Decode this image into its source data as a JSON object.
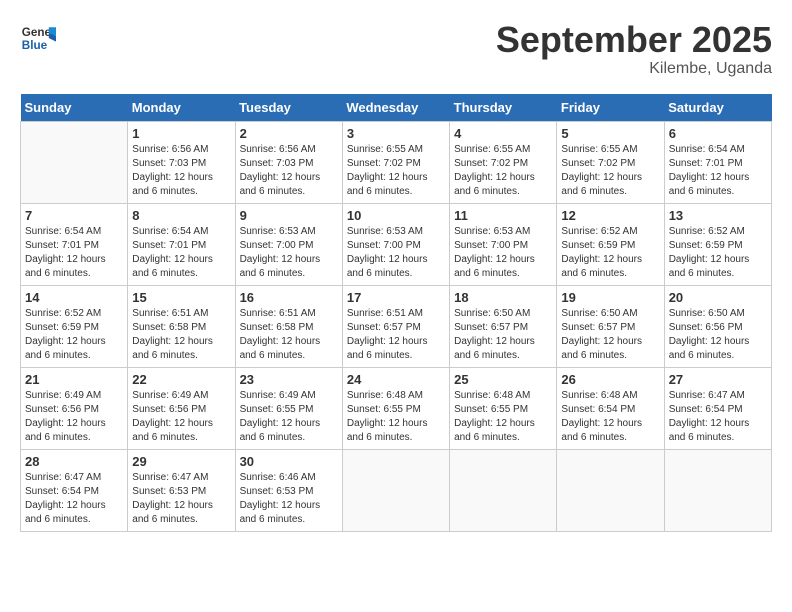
{
  "logo": {
    "line1": "General",
    "line2": "Blue"
  },
  "title": "September 2025",
  "subtitle": "Kilembe, Uganda",
  "days_of_week": [
    "Sunday",
    "Monday",
    "Tuesday",
    "Wednesday",
    "Thursday",
    "Friday",
    "Saturday"
  ],
  "weeks": [
    [
      {
        "day": "",
        "info": ""
      },
      {
        "day": "1",
        "info": "Sunrise: 6:56 AM\nSunset: 7:03 PM\nDaylight: 12 hours\nand 6 minutes."
      },
      {
        "day": "2",
        "info": "Sunrise: 6:56 AM\nSunset: 7:03 PM\nDaylight: 12 hours\nand 6 minutes."
      },
      {
        "day": "3",
        "info": "Sunrise: 6:55 AM\nSunset: 7:02 PM\nDaylight: 12 hours\nand 6 minutes."
      },
      {
        "day": "4",
        "info": "Sunrise: 6:55 AM\nSunset: 7:02 PM\nDaylight: 12 hours\nand 6 minutes."
      },
      {
        "day": "5",
        "info": "Sunrise: 6:55 AM\nSunset: 7:02 PM\nDaylight: 12 hours\nand 6 minutes."
      },
      {
        "day": "6",
        "info": "Sunrise: 6:54 AM\nSunset: 7:01 PM\nDaylight: 12 hours\nand 6 minutes."
      }
    ],
    [
      {
        "day": "7",
        "info": "Sunrise: 6:54 AM\nSunset: 7:01 PM\nDaylight: 12 hours\nand 6 minutes."
      },
      {
        "day": "8",
        "info": "Sunrise: 6:54 AM\nSunset: 7:01 PM\nDaylight: 12 hours\nand 6 minutes."
      },
      {
        "day": "9",
        "info": "Sunrise: 6:53 AM\nSunset: 7:00 PM\nDaylight: 12 hours\nand 6 minutes."
      },
      {
        "day": "10",
        "info": "Sunrise: 6:53 AM\nSunset: 7:00 PM\nDaylight: 12 hours\nand 6 minutes."
      },
      {
        "day": "11",
        "info": "Sunrise: 6:53 AM\nSunset: 7:00 PM\nDaylight: 12 hours\nand 6 minutes."
      },
      {
        "day": "12",
        "info": "Sunrise: 6:52 AM\nSunset: 6:59 PM\nDaylight: 12 hours\nand 6 minutes."
      },
      {
        "day": "13",
        "info": "Sunrise: 6:52 AM\nSunset: 6:59 PM\nDaylight: 12 hours\nand 6 minutes."
      }
    ],
    [
      {
        "day": "14",
        "info": "Sunrise: 6:52 AM\nSunset: 6:59 PM\nDaylight: 12 hours\nand 6 minutes."
      },
      {
        "day": "15",
        "info": "Sunrise: 6:51 AM\nSunset: 6:58 PM\nDaylight: 12 hours\nand 6 minutes."
      },
      {
        "day": "16",
        "info": "Sunrise: 6:51 AM\nSunset: 6:58 PM\nDaylight: 12 hours\nand 6 minutes."
      },
      {
        "day": "17",
        "info": "Sunrise: 6:51 AM\nSunset: 6:57 PM\nDaylight: 12 hours\nand 6 minutes."
      },
      {
        "day": "18",
        "info": "Sunrise: 6:50 AM\nSunset: 6:57 PM\nDaylight: 12 hours\nand 6 minutes."
      },
      {
        "day": "19",
        "info": "Sunrise: 6:50 AM\nSunset: 6:57 PM\nDaylight: 12 hours\nand 6 minutes."
      },
      {
        "day": "20",
        "info": "Sunrise: 6:50 AM\nSunset: 6:56 PM\nDaylight: 12 hours\nand 6 minutes."
      }
    ],
    [
      {
        "day": "21",
        "info": "Sunrise: 6:49 AM\nSunset: 6:56 PM\nDaylight: 12 hours\nand 6 minutes."
      },
      {
        "day": "22",
        "info": "Sunrise: 6:49 AM\nSunset: 6:56 PM\nDaylight: 12 hours\nand 6 minutes."
      },
      {
        "day": "23",
        "info": "Sunrise: 6:49 AM\nSunset: 6:55 PM\nDaylight: 12 hours\nand 6 minutes."
      },
      {
        "day": "24",
        "info": "Sunrise: 6:48 AM\nSunset: 6:55 PM\nDaylight: 12 hours\nand 6 minutes."
      },
      {
        "day": "25",
        "info": "Sunrise: 6:48 AM\nSunset: 6:55 PM\nDaylight: 12 hours\nand 6 minutes."
      },
      {
        "day": "26",
        "info": "Sunrise: 6:48 AM\nSunset: 6:54 PM\nDaylight: 12 hours\nand 6 minutes."
      },
      {
        "day": "27",
        "info": "Sunrise: 6:47 AM\nSunset: 6:54 PM\nDaylight: 12 hours\nand 6 minutes."
      }
    ],
    [
      {
        "day": "28",
        "info": "Sunrise: 6:47 AM\nSunset: 6:54 PM\nDaylight: 12 hours\nand 6 minutes."
      },
      {
        "day": "29",
        "info": "Sunrise: 6:47 AM\nSunset: 6:53 PM\nDaylight: 12 hours\nand 6 minutes."
      },
      {
        "day": "30",
        "info": "Sunrise: 6:46 AM\nSunset: 6:53 PM\nDaylight: 12 hours\nand 6 minutes."
      },
      {
        "day": "",
        "info": ""
      },
      {
        "day": "",
        "info": ""
      },
      {
        "day": "",
        "info": ""
      },
      {
        "day": "",
        "info": ""
      }
    ]
  ]
}
